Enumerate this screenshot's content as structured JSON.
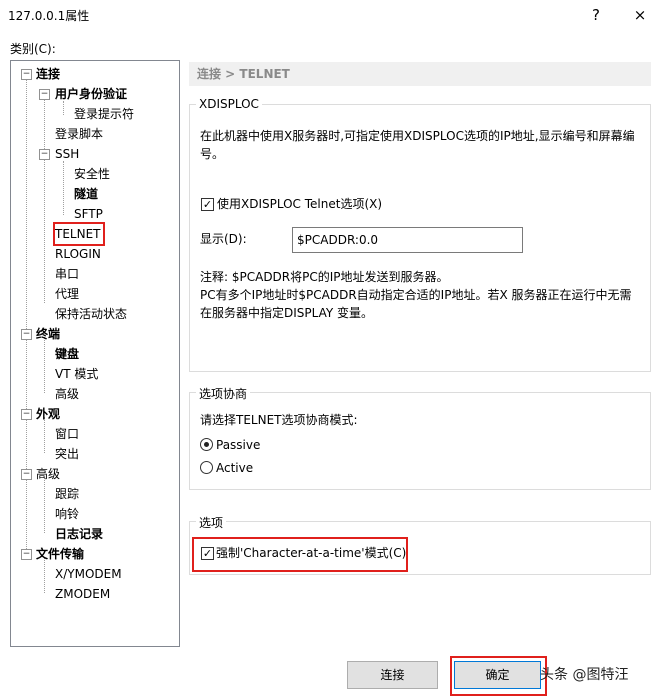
{
  "window": {
    "title": "127.0.0.1属性",
    "help": "?",
    "close": "×"
  },
  "category_label": "类别(C):",
  "tree": [
    {
      "label": "连接",
      "bold": true
    },
    {
      "label": "用户身份验证",
      "bold": true
    },
    {
      "label": "登录提示符",
      "bold": false
    },
    {
      "label": "登录脚本",
      "bold": false
    },
    {
      "label": "SSH",
      "bold": false
    },
    {
      "label": "安全性",
      "bold": false
    },
    {
      "label": "隧道",
      "bold": true
    },
    {
      "label": "SFTP",
      "bold": false
    },
    {
      "label": "TELNET",
      "bold": false,
      "selected": true
    },
    {
      "label": "RLOGIN",
      "bold": false
    },
    {
      "label": "串口",
      "bold": false
    },
    {
      "label": "代理",
      "bold": false
    },
    {
      "label": "保持活动状态",
      "bold": false
    },
    {
      "label": "终端",
      "bold": true
    },
    {
      "label": "键盘",
      "bold": true
    },
    {
      "label": "VT 模式",
      "bold": false
    },
    {
      "label": "高级",
      "bold": false
    },
    {
      "label": "外观",
      "bold": true
    },
    {
      "label": "窗口",
      "bold": false
    },
    {
      "label": "突出",
      "bold": false
    },
    {
      "label": "高级",
      "bold": false
    },
    {
      "label": "跟踪",
      "bold": false
    },
    {
      "label": "响铃",
      "bold": false
    },
    {
      "label": "日志记录",
      "bold": true
    },
    {
      "label": "文件传输",
      "bold": true
    },
    {
      "label": "X/YMODEM",
      "bold": false
    },
    {
      "label": "ZMODEM",
      "bold": false
    }
  ],
  "breadcrumb": "连接 > TELNET",
  "xdisploc": {
    "title": "XDISPLOC",
    "desc_line1": "在此机器中使用X服务器时,可指定使用XDISPLOC选项的IP地址,显示编号和屏幕编",
    "desc_line2": "号。",
    "checkbox_label": "使用XDISPLOC Telnet选项(X)",
    "checkbox_checked": true,
    "display_label": "显示(D):",
    "display_value": "$PCADDR:0.0",
    "note_line1": "注释: $PCADDR将PC的IP地址发送到服务器。",
    "note_line2": "PC有多个IP地址时$PCADDR自动指定合适的IP地址。若X 服务器正在运行中无需",
    "note_line3": "在服务器中指定DISPLAY 变量。"
  },
  "negotiation": {
    "title": "选项协商",
    "prompt": "请选择TELNET选项协商模式:",
    "options": [
      {
        "label": "Passive",
        "selected": true
      },
      {
        "label": "Active",
        "selected": false
      }
    ]
  },
  "options": {
    "title": "选项",
    "checkbox_label": "强制'Character-at-a-time'模式(C)",
    "checkbox_checked": true
  },
  "buttons": {
    "connect": "连接",
    "ok": "确定"
  },
  "watermark": "头条 @图特汪",
  "colors": {
    "highlight_box": "#e0201c",
    "breadcrumb_bg": "#f0f0f0"
  }
}
